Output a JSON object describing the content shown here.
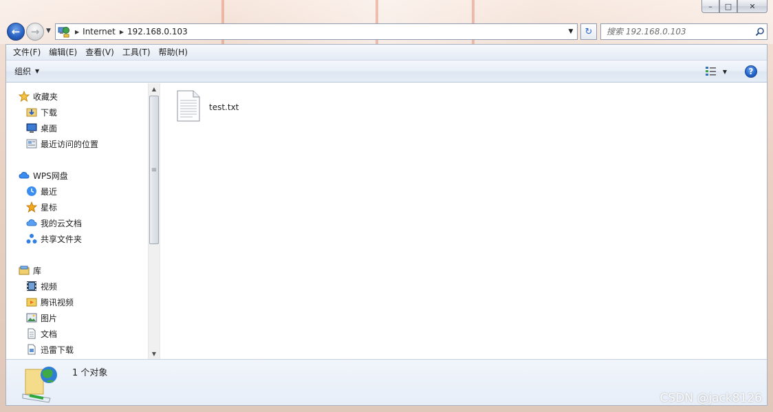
{
  "window": {
    "caption": {
      "minimize": "–",
      "maximize": "□",
      "close": "✕"
    }
  },
  "nav": {
    "back_glyph": "←",
    "forward_glyph": "→",
    "breadcrumbs": [
      "Internet",
      "192.168.0.103"
    ],
    "search_placeholder": "搜索 192.168.0.103",
    "refresh_glyph": "↻"
  },
  "menubar": {
    "items": [
      "文件(F)",
      "编辑(E)",
      "查看(V)",
      "工具(T)",
      "帮助(H)"
    ]
  },
  "toolbar": {
    "organize_label": "组织",
    "help_glyph": "?"
  },
  "navpane": {
    "favorites": {
      "title": "收藏夹",
      "items": [
        "下载",
        "桌面",
        "最近访问的位置"
      ]
    },
    "wps": {
      "title": "WPS网盘",
      "items": [
        "最近",
        "星标",
        "我的云文档",
        "共享文件夹"
      ]
    },
    "library": {
      "title": "库",
      "items": [
        "视频",
        "腾讯视频",
        "图片",
        "文档",
        "迅雷下载"
      ]
    }
  },
  "content": {
    "files": [
      {
        "name": "test.txt",
        "icon": "text-file-icon"
      }
    ]
  },
  "details": {
    "summary": "1 个对象"
  },
  "watermark": "CSDN @jack8126",
  "colors": {
    "accent": "#2a63c4",
    "pane_bg": "#e9eff8"
  }
}
